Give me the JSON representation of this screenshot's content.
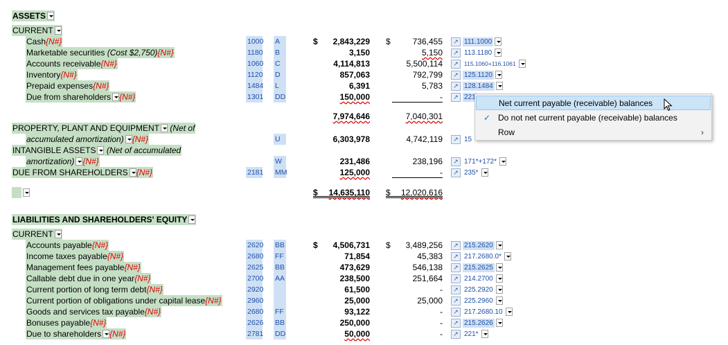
{
  "assets": {
    "title": "ASSETS",
    "current_title": "CURRENT",
    "rows": [
      {
        "label": "Cash",
        "suffix": "{N#}",
        "acct": "1000",
        "code": "A",
        "dollar1": "$",
        "v1": "2,843,229",
        "dollar2": "$",
        "v2": "736,455",
        "ref": "111.1000"
      },
      {
        "label": "Marketable securities ",
        "label_italic": "(Cost $2,750)",
        "suffix": "{N#}",
        "acct": "1180",
        "code": "B",
        "v1": "3,150",
        "v2": "5,150",
        "ref": "113.1180"
      },
      {
        "label": "Accounts receivable",
        "suffix": "{N#}",
        "acct": "1060",
        "code": "C",
        "v1": "4,114,813",
        "v2": "5,500,114",
        "ref": "115.1060+116.1061"
      },
      {
        "label": "Inventory",
        "suffix": "{N#}",
        "acct": "1120",
        "code": "D",
        "v1": "857,063",
        "v2": "792,799",
        "ref": "125.1120"
      },
      {
        "label": "Prepaid expenses",
        "suffix": "{N#}",
        "acct": "1484",
        "code": "L",
        "v1": "6,391",
        "v2": "5,783",
        "ref": "128.1484"
      },
      {
        "label": "Due from shareholders",
        "suffix": "{N#}",
        "acct": "1301",
        "code": "DD",
        "v1": "150,000",
        "v2": "-",
        "ref": "221"
      }
    ],
    "current_total_v1": "7,974,646",
    "current_total_v2": "7,040,301",
    "ppe_title": "PROPERTY, PLANT AND EQUIPMENT",
    "ppe_note_1": "(Net of",
    "ppe_note_2": "accumulated amortization)",
    "ppe_suffix": "{N#}",
    "ppe_code": "U",
    "ppe_v1": "6,303,978",
    "ppe_v2": "4,742,119",
    "ppe_ref": "15",
    "intangible_title": "INTANGIBLE ASSETS",
    "intangible_note_1": "(Net of accumulated",
    "intangible_note_2": "amortization)",
    "intangible_suffix": "{N#}",
    "intangible_code": "W",
    "intangible_v1": "231,486",
    "intangible_v2": "238,196",
    "intangible_ref": "171*+172*",
    "dfs_title": "DUE FROM SHAREHOLDERS",
    "dfs_suffix": "{N#}",
    "dfs_acct": "2181",
    "dfs_code": "MM",
    "dfs_v1": "125,000",
    "dfs_v2": "-",
    "dfs_ref": "235*",
    "total_dollar1": "$",
    "total_v1": "14,635,110",
    "total_dollar2": "$",
    "total_v2": "12,020,616"
  },
  "liabilities": {
    "title": "LIABILITIES AND SHAREHOLDERS' EQUITY",
    "current_title": "CURRENT",
    "rows": [
      {
        "label": "Accounts payable",
        "suffix": "{N#}",
        "acct": "2620",
        "code": "BB",
        "dollar1": "$",
        "v1": "4,506,731",
        "dollar2": "$",
        "v2": "3,489,256",
        "ref": "215.2620"
      },
      {
        "label": "Income taxes payable",
        "suffix": "{N#}",
        "acct": "2680",
        "code": "FF",
        "v1": "71,854",
        "v2": "45,383",
        "ref": "217.2680.0*"
      },
      {
        "label": "Management fees payable",
        "suffix": "{N#}",
        "acct": "2625",
        "code": "BB",
        "v1": "473,629",
        "v2": "546,138",
        "ref": "215.2625"
      },
      {
        "label": "Callable debt due in one year",
        "suffix": "{N#}",
        "acct": "2700",
        "code": "AA",
        "v1": "238,500",
        "v2": "251,664",
        "ref": "214.2700"
      },
      {
        "label": "Current portion of long term debt",
        "suffix": "{N#}",
        "acct": "2920",
        "code": "",
        "v1": "61,500",
        "v2": "-",
        "ref": "225.2920"
      },
      {
        "label": "Current portion of obligations under capital lease",
        "suffix": "{N#}",
        "acct": "2960",
        "code": "",
        "v1": "25,000",
        "v2": "25,000",
        "ref": "225.2960"
      },
      {
        "label": "Goods and services tax payable",
        "suffix": "{N#}",
        "acct": "2680",
        "code": "FF",
        "v1": "93,122",
        "v2": "-",
        "ref": "217.2680.10"
      },
      {
        "label": "Bonuses payable",
        "suffix": "{N#}",
        "acct": "2626",
        "code": "BB",
        "v1": "250,000",
        "v2": "-",
        "ref": "215.2626"
      },
      {
        "label": "Due to shareholders",
        "suffix": "{N#}",
        "acct": "2781",
        "code": "DD",
        "v1": "50,000",
        "v2": "-",
        "ref": "221*"
      }
    ]
  },
  "context_menu": {
    "items": [
      {
        "label": "Net current payable (receivable) balances",
        "checked": false,
        "highlighted": true
      },
      {
        "label": "Do not net current payable (receivable) balances",
        "checked": true
      },
      {
        "label": "Row",
        "submenu": true
      }
    ],
    "check_glyph": "✓",
    "submenu_glyph": "›"
  },
  "colors": {
    "highlight": "#c5dfc5",
    "cell_blue": "#cfe0f5",
    "red_tag": "#e00000"
  }
}
